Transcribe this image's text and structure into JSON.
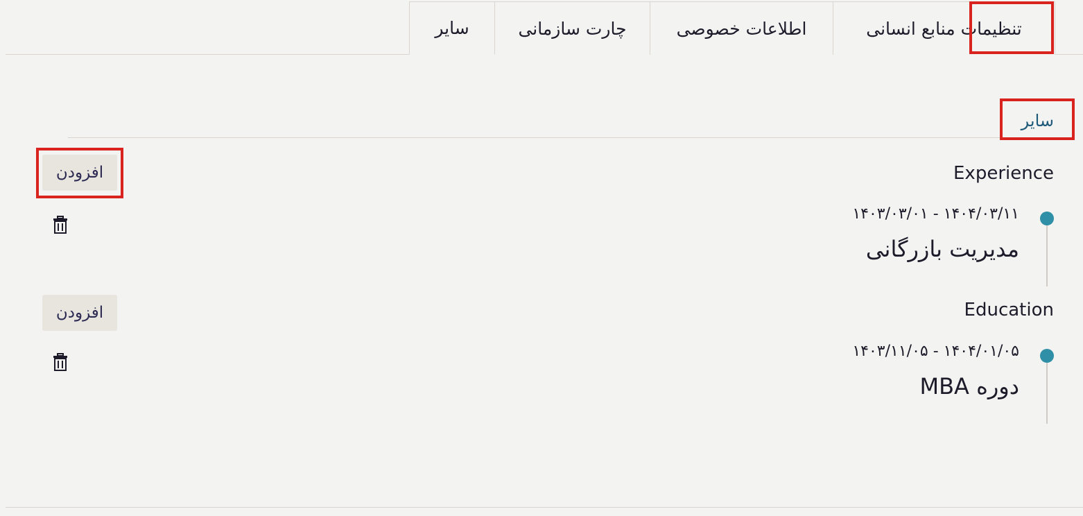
{
  "tabs": [
    {
      "label": "سایر",
      "active": true
    },
    {
      "label": "چارت سازمانی",
      "active": false
    },
    {
      "label": "اطلاعات خصوصی",
      "active": false
    },
    {
      "label": "تنظیمات منابع انسانی",
      "active": false
    }
  ],
  "section": {
    "title": "سایر"
  },
  "groups": [
    {
      "title": "Experience",
      "add_label": "افزودن",
      "entry": {
        "date_range": "۱۴۰۴/۰۳/۱۱ - ۱۴۰۳/۰۳/۰۱",
        "title": "مدیریت بازرگانی"
      }
    },
    {
      "title": "Education",
      "add_label": "افزودن",
      "entry": {
        "date_range": "۱۴۰۴/۰۱/۰۵ - ۱۴۰۳/۱۱/۰۵",
        "title": "دوره MBA"
      }
    }
  ],
  "colors": {
    "accent": "#2e8fa6",
    "highlight": "#d9231f",
    "section_title": "#1e5a7a",
    "button_bg": "#e8e4de"
  },
  "icons": {
    "delete": "trash-icon",
    "timeline": "timeline-dot"
  }
}
